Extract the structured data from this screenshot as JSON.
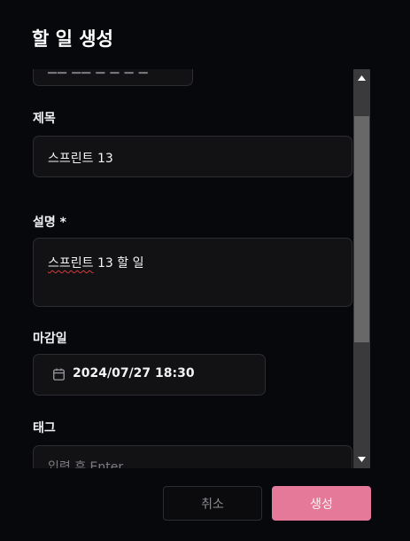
{
  "dialog": {
    "title": "할 일 생성"
  },
  "form": {
    "title_label": "제목",
    "title_value": "스프린트 13",
    "description_label": "설명 *",
    "description_value_misspelled": "스프린트",
    "description_value_rest": " 13 할 일",
    "due_label": "마감일",
    "due_value": "2024/07/27 18:30",
    "tags_label": "태그",
    "tags_placeholder": "입력 후 Enter",
    "top_partial_text": "▁▁ ▁▁ ▁ ▁ ▁ ▁"
  },
  "footer": {
    "cancel_label": "취소",
    "create_label": "생성"
  },
  "colors": {
    "background": "#07080c",
    "field_background": "#121215",
    "accent": "#e5799a",
    "scrollbar_track": "#3a3a3d",
    "scrollbar_thumb": "#686868"
  },
  "icons": {
    "due_date": "calendar-icon",
    "scroll_up": "arrow-up-icon",
    "scroll_down": "arrow-down-icon"
  }
}
